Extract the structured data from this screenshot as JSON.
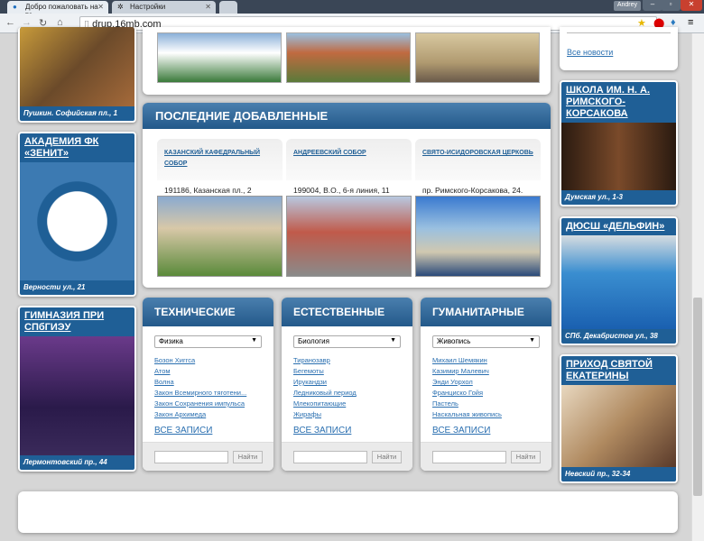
{
  "browser": {
    "tabs": [
      {
        "label": "Добро пожаловать на те",
        "active": true
      },
      {
        "label": "Настройки",
        "active": false
      }
    ],
    "user": "Andrey",
    "url": "drup.16mb.com"
  },
  "left_cards": [
    {
      "title": "",
      "caption": "Пушкин. Софийская пл., 1"
    },
    {
      "title": "АКАДЕМИЯ ФК «ЗЕНИТ»",
      "caption": "Верности ул., 21"
    },
    {
      "title": "ГИМНАЗИЯ ПРИ СПбГИЭУ",
      "caption": "Лермонтовский пр., 44"
    }
  ],
  "right_cards": [
    {
      "title": "ШКОЛА ИМ. Н. А. РИМСКОГО-КОРСАКОВА",
      "caption": "Думская ул., 1-3"
    },
    {
      "title": "ДЮСШ «ДЕЛЬФИН»",
      "caption": "СПб. Декабристов ул., 38"
    },
    {
      "title": "ПРИХОД СВЯТОЙ ЕКАТЕРИНЫ",
      "caption": "Невский пр., 32-34"
    }
  ],
  "news": {
    "all_link": "Все новости"
  },
  "latest": {
    "title": "ПОСЛЕДНИЕ ДОБАВЛЕННЫЕ",
    "items": [
      {
        "title": "КАЗАНСКИЙ КАФЕДРАЛЬНЫЙ СОБОР",
        "address": "191186, Казанская пл., 2"
      },
      {
        "title": "АНДРЕЕВСКИЙ СОБОР",
        "address": "199004, В.О., 6-я линия, 11"
      },
      {
        "title": "СВЯТО-ИСИДОРОВСКАЯ ЦЕРКОВЬ",
        "address": "пр. Римского-Корсакова, 24."
      }
    ]
  },
  "categories": [
    {
      "title": "ТЕХНИЧЕСКИЕ",
      "selected": "Физика",
      "links": [
        "Бозон Хиггса",
        "Атом",
        "Волна",
        "Закон Всемирного тяготени...",
        "Закон Сохранения импульса",
        "Закон Архимеда"
      ],
      "all": "ВСЕ ЗАПИСИ",
      "button": "Найти"
    },
    {
      "title": "ЕСТЕСТВЕННЫЕ",
      "selected": "Биология",
      "links": [
        "Тиранозавр",
        "Бегемоты",
        "Ирукандзи",
        "Ледниковый период",
        "Млекопитающие",
        "Жирафы"
      ],
      "all": "ВСЕ ЗАПИСИ",
      "button": "Найти"
    },
    {
      "title": "ГУМАНИТАРНЫЕ",
      "selected": "Живопись",
      "links": [
        "Михаил Шемякин",
        "Казимир Малевич",
        "Энди Уорхол",
        "Франциско Гойя",
        "Пастель",
        "Наскальная живопись"
      ],
      "all": "ВСЕ ЗАПИСИ",
      "button": "Найти"
    }
  ]
}
